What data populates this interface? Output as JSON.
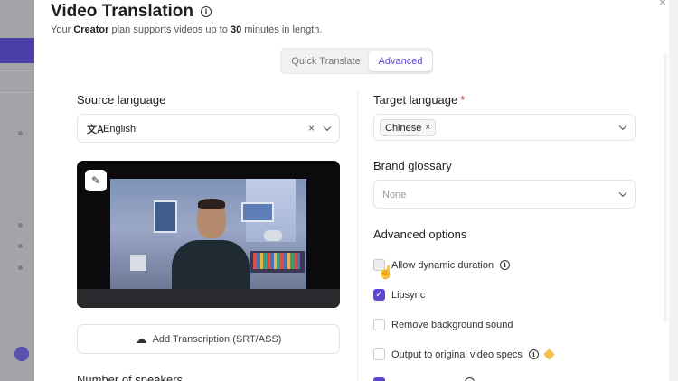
{
  "modal": {
    "title": "Video Translation",
    "subtitle_prefix": "Your ",
    "plan_name": "Creator",
    "subtitle_middle": " plan supports videos up to ",
    "minutes": "30",
    "subtitle_suffix": " minutes in length.",
    "close": "×"
  },
  "tabs": [
    {
      "label": "Quick Translate",
      "active": false
    },
    {
      "label": "Advanced",
      "active": true
    }
  ],
  "source": {
    "label": "Source language",
    "icon": "translate-icon",
    "value": "English"
  },
  "target": {
    "label": "Target language",
    "required_mark": "*",
    "chip": "Chinese",
    "chip_remove": "×"
  },
  "glossary": {
    "label": "Brand glossary",
    "value": "None"
  },
  "advanced": {
    "label": "Advanced options",
    "options": [
      {
        "label": "Allow dynamic duration",
        "checked": false,
        "info": true
      },
      {
        "label": "Lipsync",
        "checked": true
      },
      {
        "label": "Remove background sound",
        "checked": false
      },
      {
        "label": "Output to original video specs",
        "checked": false,
        "info": true,
        "premium": true
      }
    ]
  },
  "transcription": {
    "label": "Add Transcription (SRT/ASS)",
    "icon": "cloud-upload-icon"
  },
  "speakers": {
    "label": "Number of speakers"
  },
  "colors": {
    "accent": "#5b48d0",
    "premium": "#f2c14a"
  }
}
